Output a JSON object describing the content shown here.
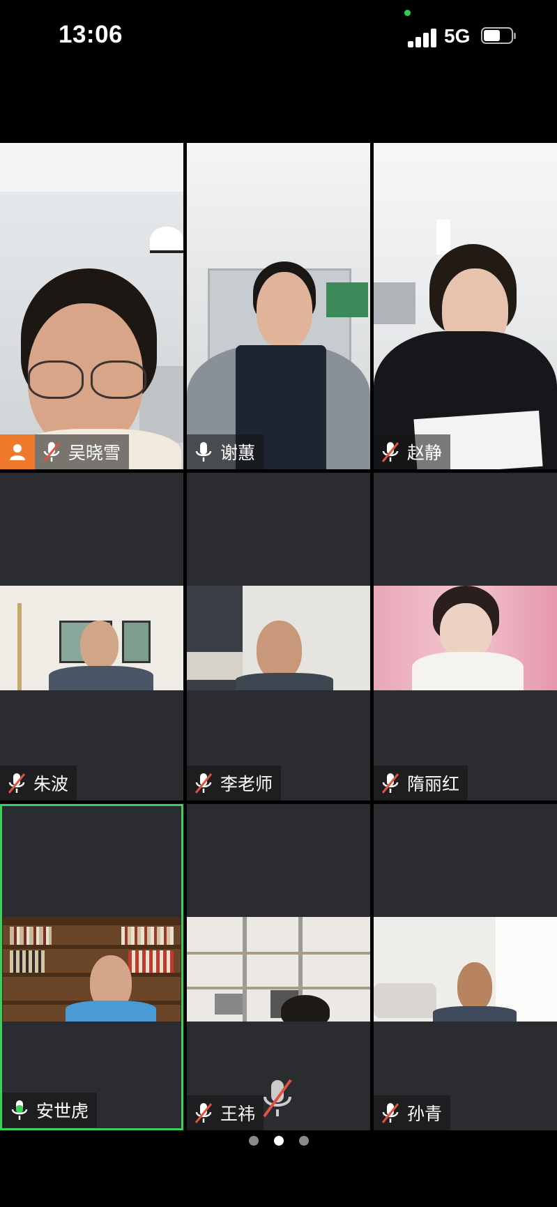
{
  "status_bar": {
    "time": "13:06",
    "network": "5G",
    "signal_bars": 4,
    "battery_level": 0.6
  },
  "participants": [
    {
      "name": "吴晓雪",
      "mic": "muted",
      "role": "host",
      "video": "on"
    },
    {
      "name": "谢蕙",
      "mic": "on",
      "video": "on"
    },
    {
      "name": "赵静",
      "mic": "muted",
      "video": "on"
    },
    {
      "name": "朱波",
      "mic": "muted",
      "video": "on"
    },
    {
      "name": "李老师",
      "mic": "muted",
      "video": "on"
    },
    {
      "name": "隋丽红",
      "mic": "muted",
      "video": "on"
    },
    {
      "name": "安世虎",
      "mic": "speaking",
      "video": "on",
      "active_speaker": true
    },
    {
      "name": "王祎",
      "mic": "muted",
      "video": "on"
    },
    {
      "name": "孙青",
      "mic": "muted",
      "video": "on"
    }
  ],
  "pagination": {
    "total": 3,
    "current": 2
  },
  "colors": {
    "background": "#000000",
    "tile": "#2a2c2f",
    "active_border": "#3ccf5a",
    "host_badge": "#f07a2c",
    "muted_slash": "#e0533f"
  },
  "icons": {
    "muted_mic": "microphone-off-icon",
    "mic": "microphone-icon",
    "host": "person-icon"
  }
}
